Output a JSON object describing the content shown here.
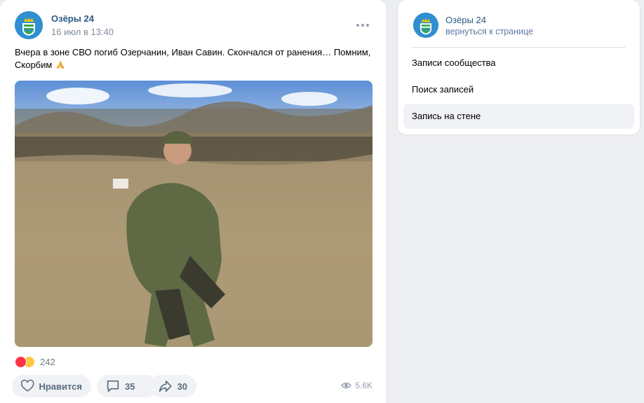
{
  "post": {
    "author": "Озёры 24",
    "date": "16 июл в 13:40",
    "text": "Вчера в зоне СВО погиб Озерчанин, Иван Савин. Скончался от ранения… Помним, Скорбим",
    "reaction_count": "242",
    "actions": {
      "like_label": "Нравится",
      "comments_count": "35",
      "shares_count": "30",
      "views": "5.6K"
    }
  },
  "sidebar": {
    "group_name": "Озёры 24",
    "back_link": "вернуться к странице",
    "menu": [
      {
        "label": "Записи сообщества"
      },
      {
        "label": "Поиск записей"
      },
      {
        "label": "Запись на стене"
      }
    ]
  },
  "colors": {
    "link": "#2a5885",
    "muted": "#818c99",
    "button_bg": "#f0f2f5",
    "heart": "#ff3347"
  }
}
